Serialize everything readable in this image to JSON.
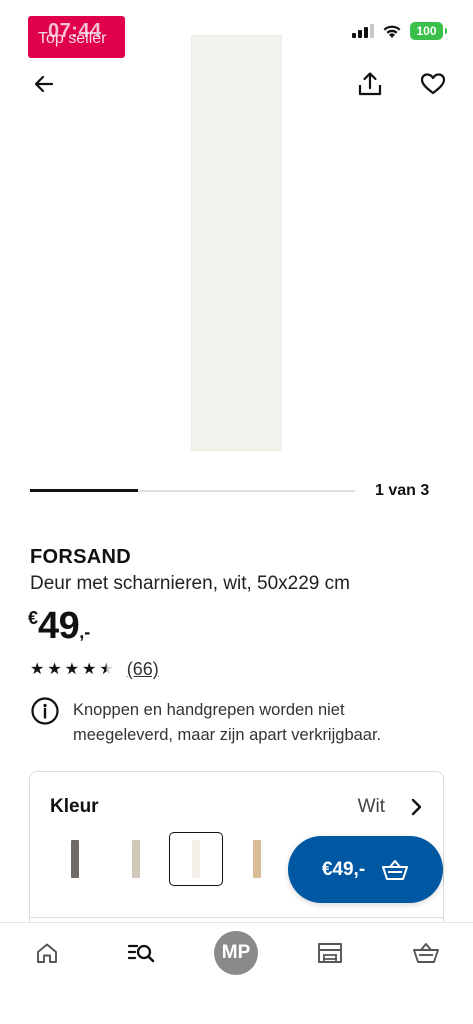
{
  "status_bar": {
    "time": "07:44",
    "battery": "100",
    "signal_icon": "cellular-signal-icon",
    "wifi_icon": "wifi-icon"
  },
  "badge": {
    "label": "Top seller"
  },
  "nav": {
    "back_icon": "arrow-left-icon",
    "share_icon": "share-icon",
    "favorite_icon": "heart-icon"
  },
  "carousel": {
    "counter": "1 van 3",
    "progress": 0.333
  },
  "product": {
    "name": "FORSAND",
    "description": "Deur met scharnieren, wit, 50x229 cm",
    "price_currency": "€",
    "price_integer": "49",
    "price_decimal": ",-",
    "rating": 4.5,
    "review_count": "(66)"
  },
  "info": {
    "icon": "info-circle-icon",
    "text": "Knoppen en handgrepen worden niet meegeleverd, maar zijn apart verkrijgbaar."
  },
  "color_selector": {
    "label": "Kleur",
    "value": "Wit",
    "chevron_icon": "chevron-right-icon",
    "swatches": [
      {
        "color": "#6e6a66",
        "selected": false
      },
      {
        "color": "#d4c8b8",
        "selected": false
      },
      {
        "color": "#f2f0e8",
        "selected": true
      },
      {
        "color": "#d9bc98",
        "selected": false
      }
    ]
  },
  "cart_button": {
    "label": "€49,-",
    "icon": "shopping-basket-icon",
    "color": "#0058a3"
  },
  "bottom_nav": {
    "tabs": [
      {
        "name": "home",
        "icon": "home-icon"
      },
      {
        "name": "search",
        "icon": "search-list-icon"
      },
      {
        "name": "profile",
        "avatar_text": "MP"
      },
      {
        "name": "store",
        "icon": "store-icon"
      },
      {
        "name": "basket",
        "icon": "shopping-basket-icon"
      }
    ]
  },
  "colors": {
    "badge": "#e0004d",
    "accent": "#0058a3",
    "battery": "#3ac04a"
  }
}
